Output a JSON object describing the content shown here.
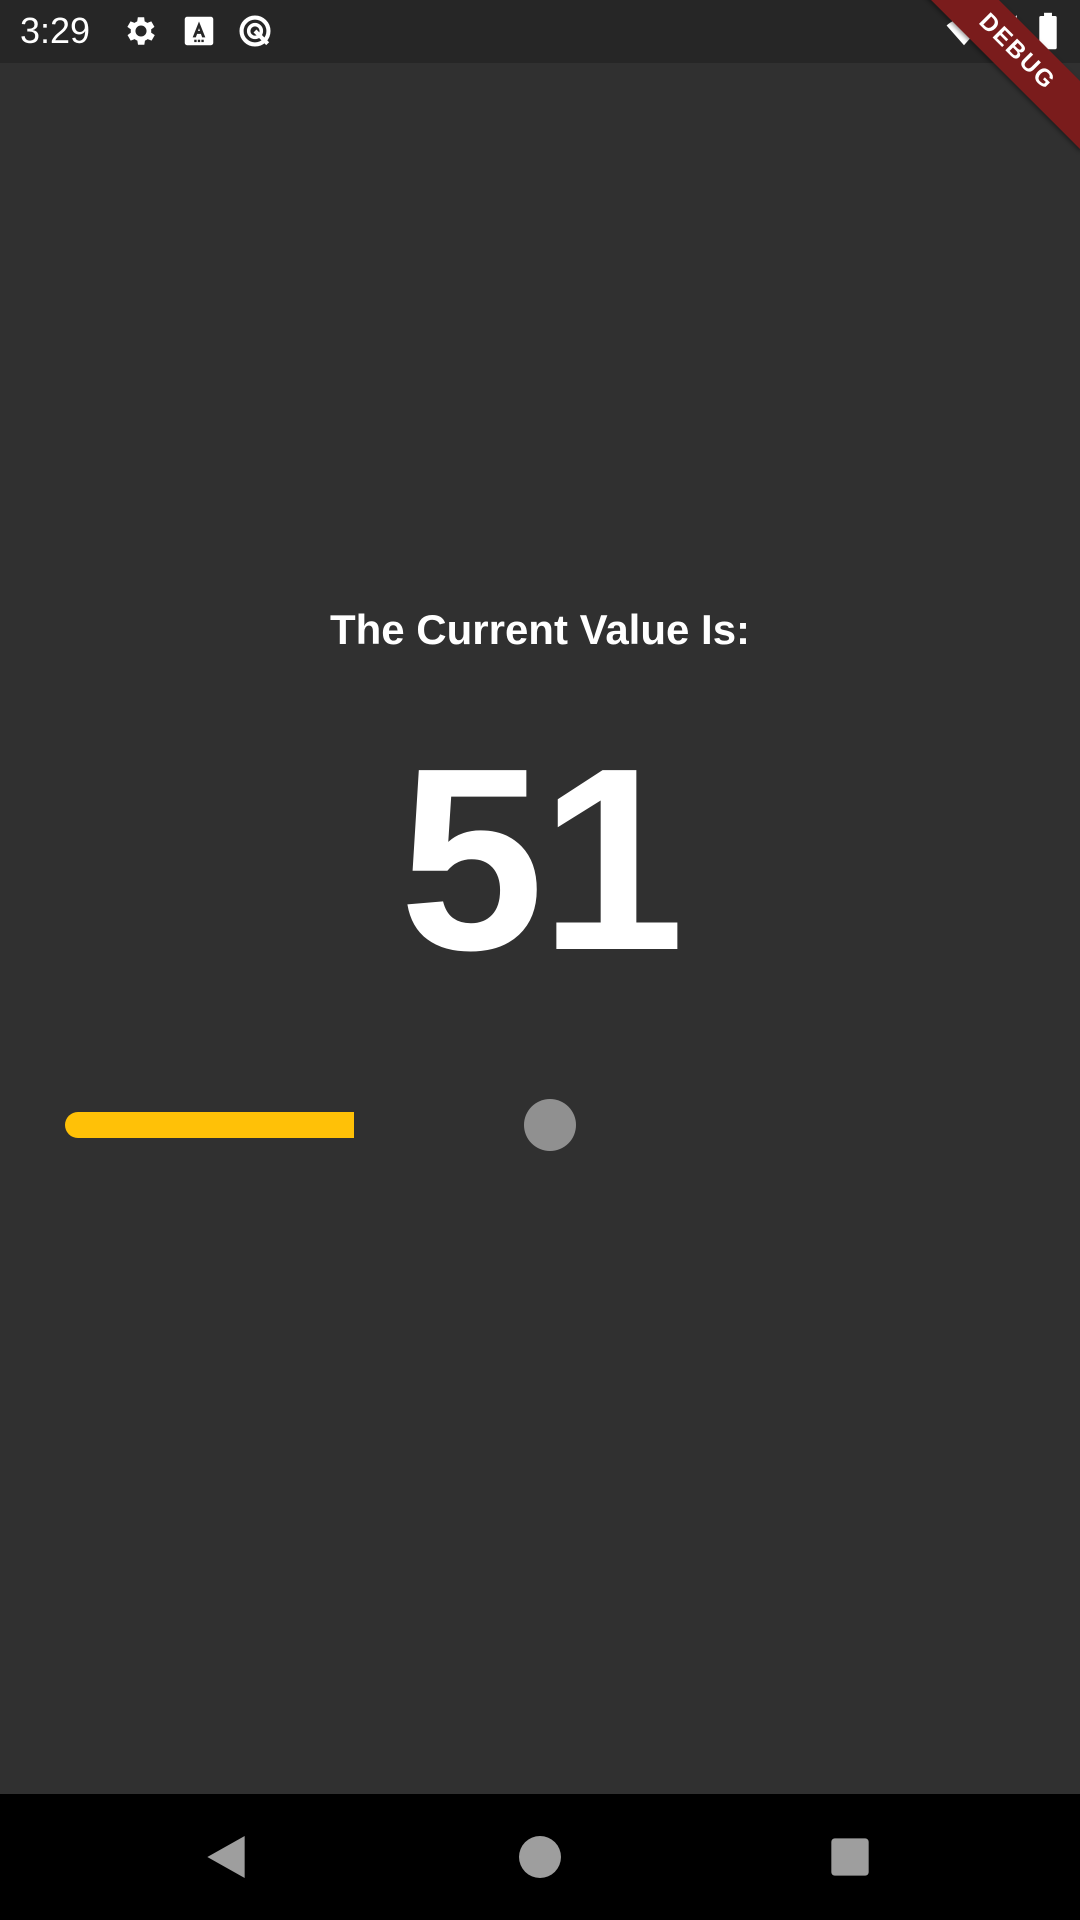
{
  "status_bar": {
    "time": "3:29",
    "left_icons": [
      "gear-icon",
      "text-a-icon",
      "circle-slash-icon"
    ],
    "right_icons": [
      "wifi-icon",
      "signal-icon",
      "battery-icon"
    ]
  },
  "debug_banner": {
    "label": "DEBUG",
    "color": "#7a1c1c"
  },
  "main": {
    "caption": "The Current Value Is:",
    "value": "51"
  },
  "slider": {
    "value": 51,
    "min": 0,
    "max": 100,
    "active_color": "#ffc107",
    "thumb_color": "#909090"
  },
  "nav_bar": {
    "buttons": [
      "back-icon",
      "home-icon",
      "recents-icon"
    ]
  },
  "colors": {
    "background": "#303030",
    "status_bar": "#262626",
    "text": "#ffffff"
  }
}
